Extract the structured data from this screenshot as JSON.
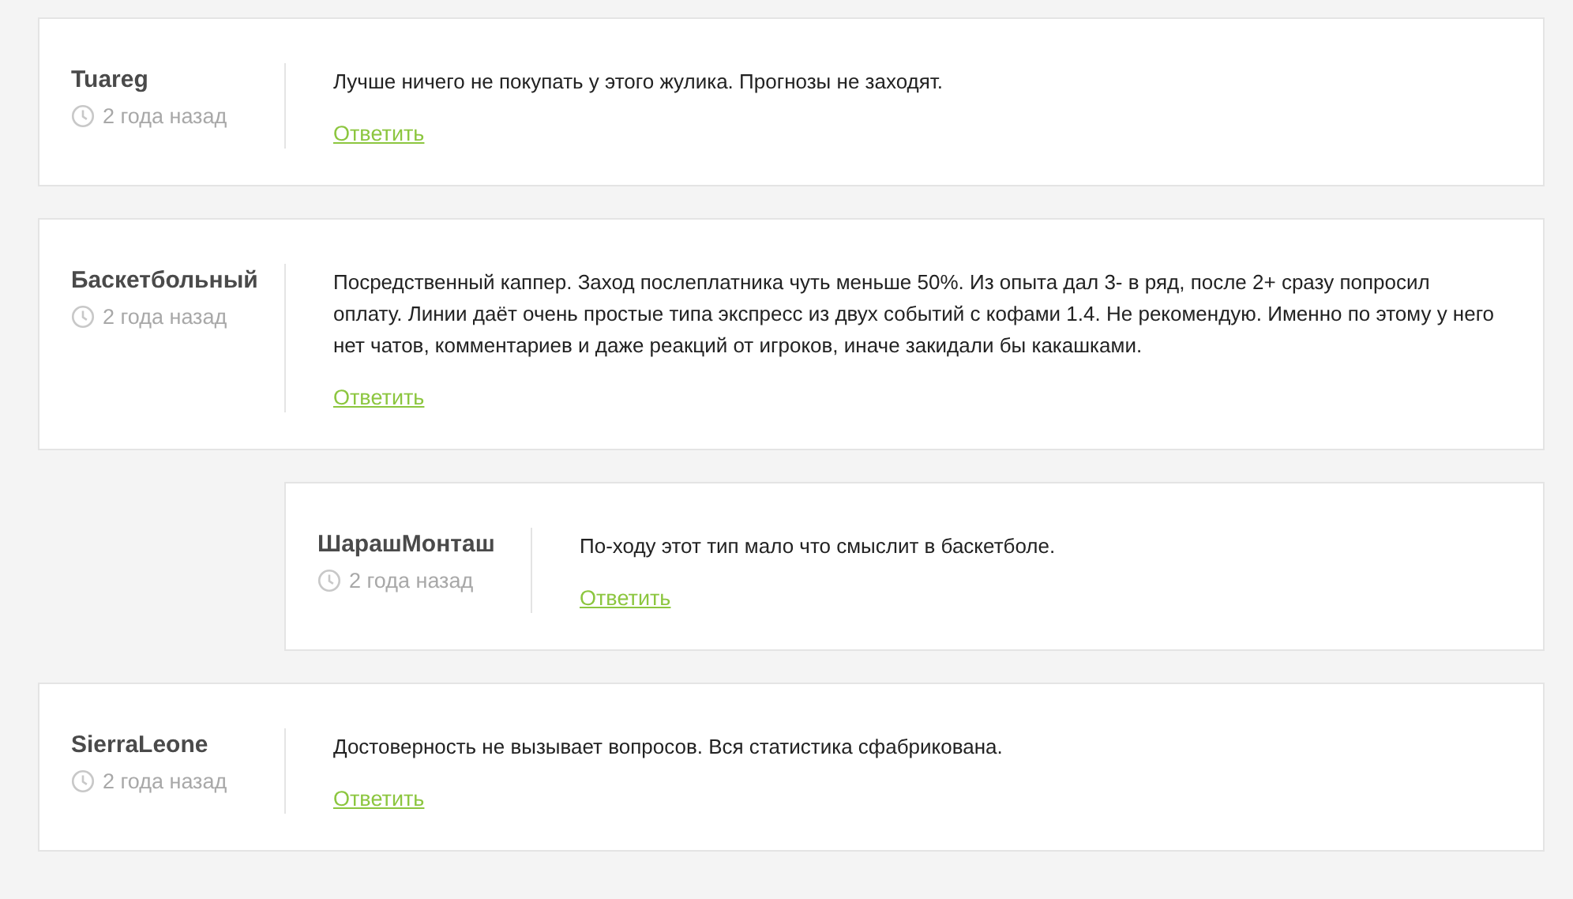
{
  "comments": [
    {
      "author": "Tuareg",
      "time": "2 года назад",
      "text": "Лучше ничего не покупать у этого жулика. Прогнозы не заходят.",
      "reply": "Ответить"
    },
    {
      "author": "Баскетбольный",
      "time": "2 года назад",
      "text": "Посредственный каппер. Заход послеплатника чуть меньше 50%. Из опыта дал 3- в ряд, после 2+ сразу попросил оплату. Линии даёт очень простые типа экспресс из двух событий с кофами 1.4. Не рекомендую. Именно по этому у него нет чатов, комментариев и даже реакций от игроков, иначе закидали бы какашками.",
      "reply": "Ответить",
      "children": [
        {
          "author": "ШарашМонташ",
          "time": "2 года назад",
          "text": "По-ходу этот тип мало что смыслит в баскетболе.",
          "reply": "Ответить"
        }
      ]
    },
    {
      "author": "SierraLeone",
      "time": "2 года назад",
      "text": "Достоверность не вызывает вопросов. Вся статистика сфабрикована.",
      "reply": "Ответить"
    }
  ]
}
